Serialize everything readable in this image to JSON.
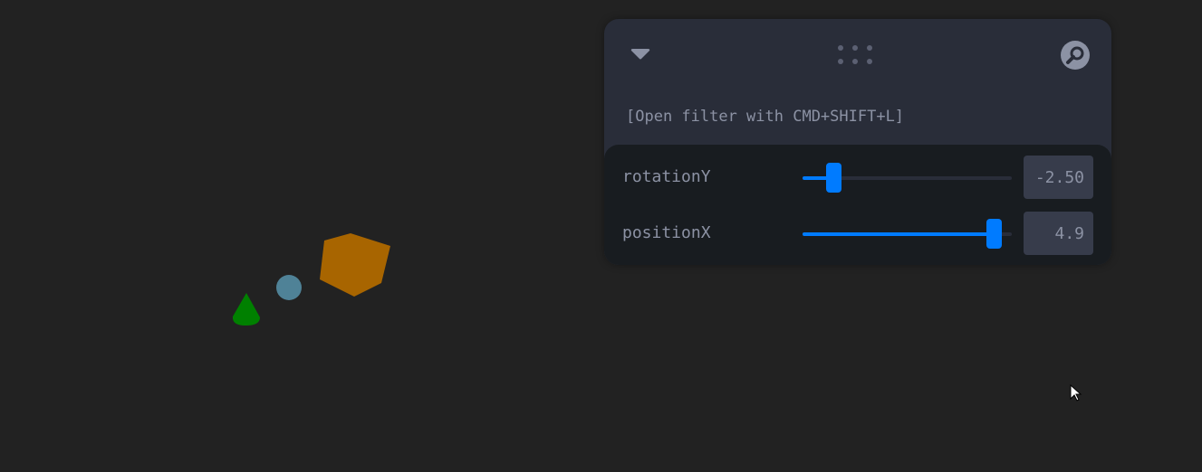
{
  "scene": {
    "background": "#222222",
    "objects": [
      {
        "shape": "cone",
        "color": "#008000"
      },
      {
        "shape": "sphere",
        "color": "#4f8297"
      },
      {
        "shape": "dodecahedron",
        "color": "#a86500"
      }
    ]
  },
  "panel": {
    "background": "#292d39",
    "titlebar": {
      "collapse_icon": "chevron-down-icon",
      "drag_icon": "drag-dots-icon",
      "search_icon": "search-icon"
    },
    "filter_hint": "[Open filter with CMD+SHIFT+L]",
    "controls": [
      {
        "label": "rotationY",
        "value": "-2.50",
        "slider_fraction": 0.12
      },
      {
        "label": "positionX",
        "value": "4.9",
        "slider_fraction": 0.95
      }
    ],
    "accent": "#007bff"
  }
}
